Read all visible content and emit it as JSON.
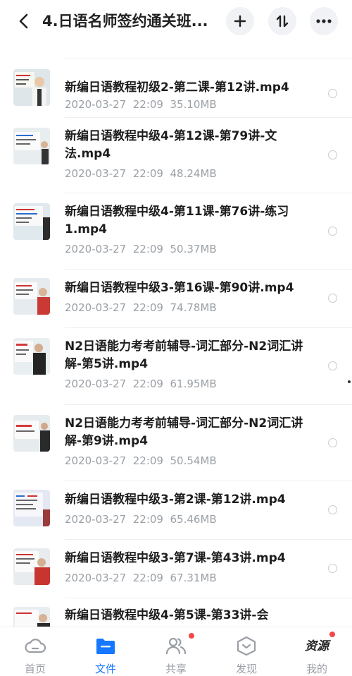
{
  "header": {
    "title": "4.日语名师签约通关班...",
    "actions": [
      "add-icon",
      "sort-icon",
      "more-icon"
    ]
  },
  "files": [
    {
      "name": "新编日语教程初级2-第二课-第12讲.mp4",
      "date": "2020-03-27",
      "time": "22:09",
      "size": "35.10MB"
    },
    {
      "name": "新编日语教程中级4-第12课-第79讲-文法.mp4",
      "date": "2020-03-27",
      "time": "22:09",
      "size": "48.24MB"
    },
    {
      "name": "新编日语教程中级4-第11课-第76讲-练习1.mp4",
      "date": "2020-03-27",
      "time": "22:09",
      "size": "50.37MB"
    },
    {
      "name": "新编日语教程中级3-第16课-第90讲.mp4",
      "date": "2020-03-27",
      "time": "22:09",
      "size": "74.78MB"
    },
    {
      "name": "N2日语能力考考前辅导-词汇部分-N2词汇讲解-第5讲.mp4",
      "date": "2020-03-27",
      "time": "22:09",
      "size": "61.95MB"
    },
    {
      "name": "N2日语能力考考前辅导-词汇部分-N2词汇讲解-第9讲.mp4",
      "date": "2020-03-27",
      "time": "22:09",
      "size": "50.54MB"
    },
    {
      "name": "新编日语教程中级3-第2课-第12讲.mp4",
      "date": "2020-03-27",
      "time": "22:09",
      "size": "65.46MB"
    },
    {
      "name": "新编日语教程中级3-第7课-第43讲.mp4",
      "date": "2020-03-27",
      "time": "22:09",
      "size": "67.31MB"
    },
    {
      "name": "新编日语教程中级4-第5课-第33讲-会",
      "date": "",
      "time": "",
      "size": ""
    }
  ],
  "tabbar": {
    "items": [
      {
        "label": "首页",
        "icon": "home-cloud-icon",
        "active": false,
        "badge": false
      },
      {
        "label": "文件",
        "icon": "folder-icon",
        "active": true,
        "badge": false
      },
      {
        "label": "共享",
        "icon": "share-people-icon",
        "active": false,
        "badge": true
      },
      {
        "label": "发现",
        "icon": "discover-box-icon",
        "active": false,
        "badge": false
      },
      {
        "label": "我的",
        "icon": "profile-logo-icon",
        "active": false,
        "badge": true
      }
    ],
    "logo_text": "资源"
  },
  "colors": {
    "accent": "#1677ff",
    "badge": "#f24848",
    "meta": "#9aa0a6"
  }
}
